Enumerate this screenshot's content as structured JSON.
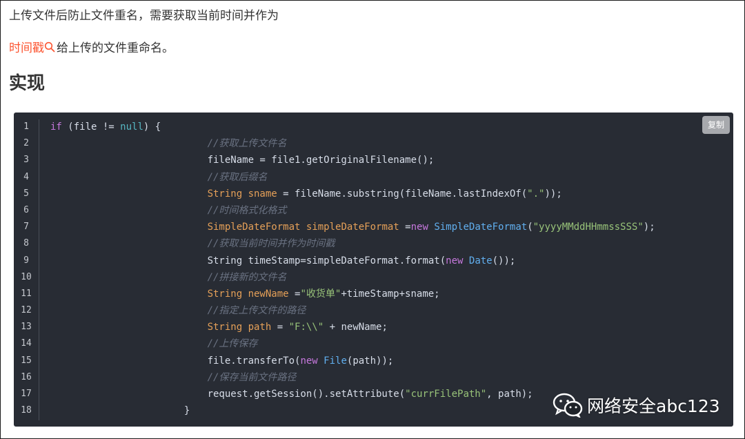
{
  "article": {
    "paragraph1": "上传文件后防止文件重名，需要获取当前时间并作为",
    "paragraph2_link": "时间戳",
    "paragraph2_rest": "给上传的文件重命名。",
    "heading": "实现"
  },
  "code_block": {
    "copy_label": "复制",
    "line_numbers": [
      "1",
      "2",
      "3",
      "4",
      "5",
      "6",
      "7",
      "8",
      "9",
      "10",
      "11",
      "12",
      "13",
      "14",
      "15",
      "16",
      "17",
      "18"
    ],
    "lines": [
      [
        {
          "c": "kw",
          "t": "if"
        },
        {
          "c": "pl",
          "t": " (file != "
        },
        {
          "c": "lit",
          "t": "null"
        },
        {
          "c": "pl",
          "t": ") {"
        }
      ],
      [
        {
          "c": "pl",
          "t": "                           "
        },
        {
          "c": "cm",
          "t": "//获取上传文件名"
        }
      ],
      [
        {
          "c": "pl",
          "t": "                           fileName = file1.getOriginalFilename();"
        }
      ],
      [
        {
          "c": "pl",
          "t": "                           "
        },
        {
          "c": "cm",
          "t": "//获取后缀名"
        }
      ],
      [
        {
          "c": "pl",
          "t": "                           "
        },
        {
          "c": "ty",
          "t": "String sname"
        },
        {
          "c": "pl",
          "t": " = fileName.substring(fileName.lastIndexOf("
        },
        {
          "c": "str",
          "t": "\".\""
        },
        {
          "c": "pl",
          "t": "));"
        }
      ],
      [
        {
          "c": "pl",
          "t": "                           "
        },
        {
          "c": "cm",
          "t": "//时间格式化格式"
        }
      ],
      [
        {
          "c": "pl",
          "t": "                           "
        },
        {
          "c": "ty",
          "t": "SimpleDateFormat simpleDateFormat"
        },
        {
          "c": "pl",
          "t": " ="
        },
        {
          "c": "kw",
          "t": "new"
        },
        {
          "c": "pl",
          "t": " "
        },
        {
          "c": "fn",
          "t": "SimpleDateFormat"
        },
        {
          "c": "pl",
          "t": "("
        },
        {
          "c": "str",
          "t": "\"yyyyMMddHHmmssSSS\""
        },
        {
          "c": "pl",
          "t": ");"
        }
      ],
      [
        {
          "c": "pl",
          "t": "                           "
        },
        {
          "c": "cm",
          "t": "//获取当前时间并作为时间戳"
        }
      ],
      [
        {
          "c": "pl",
          "t": "                           String timeStamp=simpleDateFormat.format("
        },
        {
          "c": "kw",
          "t": "new"
        },
        {
          "c": "pl",
          "t": " "
        },
        {
          "c": "fn",
          "t": "Date"
        },
        {
          "c": "pl",
          "t": "());"
        }
      ],
      [
        {
          "c": "pl",
          "t": "                           "
        },
        {
          "c": "cm",
          "t": "//拼接新的文件名"
        }
      ],
      [
        {
          "c": "pl",
          "t": "                           "
        },
        {
          "c": "ty",
          "t": "String newName"
        },
        {
          "c": "pl",
          "t": " ="
        },
        {
          "c": "str",
          "t": "\"收货单\""
        },
        {
          "c": "pl",
          "t": "+timeStamp+sname;"
        }
      ],
      [
        {
          "c": "pl",
          "t": "                           "
        },
        {
          "c": "cm",
          "t": "//指定上传文件的路径"
        }
      ],
      [
        {
          "c": "pl",
          "t": "                           "
        },
        {
          "c": "ty",
          "t": "String path"
        },
        {
          "c": "pl",
          "t": " = "
        },
        {
          "c": "str",
          "t": "\"F:\\\\\""
        },
        {
          "c": "pl",
          "t": " + newName;"
        }
      ],
      [
        {
          "c": "pl",
          "t": "                           "
        },
        {
          "c": "cm",
          "t": "//上传保存"
        }
      ],
      [
        {
          "c": "pl",
          "t": "                           file.transferTo("
        },
        {
          "c": "kw",
          "t": "new"
        },
        {
          "c": "pl",
          "t": " "
        },
        {
          "c": "fn",
          "t": "File"
        },
        {
          "c": "pl",
          "t": "(path));"
        }
      ],
      [
        {
          "c": "pl",
          "t": "                           "
        },
        {
          "c": "cm",
          "t": "//保存当前文件路径"
        }
      ],
      [
        {
          "c": "pl",
          "t": "                           request.getSession().setAttribute("
        },
        {
          "c": "str",
          "t": "\"currFilePath\""
        },
        {
          "c": "pl",
          "t": ", path);"
        }
      ],
      [
        {
          "c": "pl",
          "t": "                       }"
        }
      ]
    ]
  },
  "watermark": {
    "text": "网络安全abc123",
    "icon": "wechat-icon"
  },
  "colors": {
    "link": "#fc5531",
    "code_bg": "#282c34",
    "keyword": "#c678dd",
    "string": "#98c379",
    "type": "#e5a058",
    "function": "#61afef",
    "comment": "#6a7282"
  }
}
